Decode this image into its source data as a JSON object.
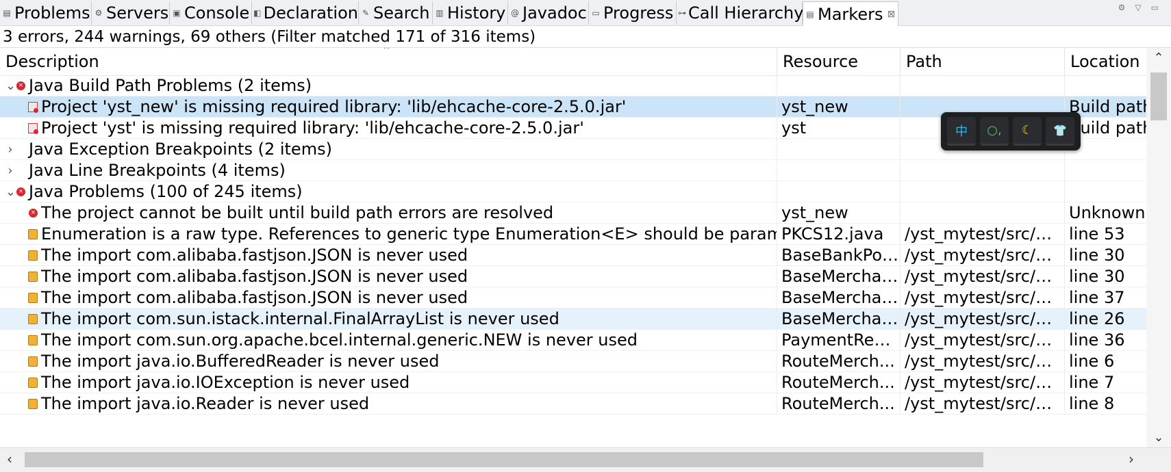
{
  "tabs": [
    {
      "label": "Problems",
      "icon": "problems-icon"
    },
    {
      "label": "Servers",
      "icon": "servers-icon"
    },
    {
      "label": "Console",
      "icon": "console-icon"
    },
    {
      "label": "Declaration",
      "icon": "declaration-icon"
    },
    {
      "label": "Search",
      "icon": "search-icon"
    },
    {
      "label": "History",
      "icon": "history-icon"
    },
    {
      "label": "Javadoc",
      "icon": "javadoc-icon"
    },
    {
      "label": "Progress",
      "icon": "progress-icon"
    },
    {
      "label": "Call Hierarchy",
      "icon": "call-hierarchy-icon"
    },
    {
      "label": "Markers",
      "icon": "markers-icon",
      "active": true,
      "close": "⊠"
    }
  ],
  "summary": "3 errors, 244 warnings, 69 others (Filter matched 171 of 316 items)",
  "columns": {
    "description": "Description",
    "resource": "Resource",
    "path": "Path",
    "location": "Location"
  },
  "rows": [
    {
      "type": "group",
      "twisty": "⌄",
      "icon": "error",
      "description": "Java Build Path Problems (2 items)",
      "resource": "",
      "path": "",
      "location": ""
    },
    {
      "type": "item",
      "icon": "lib",
      "description": "Project 'yst_new' is missing required library: 'lib/ehcache-core-2.5.0.jar'",
      "resource": "yst_new",
      "path": "",
      "location": "Build path",
      "state": "selected"
    },
    {
      "type": "item",
      "icon": "lib",
      "description": "Project 'yst' is missing required library: 'lib/ehcache-core-2.5.0.jar'",
      "resource": "yst",
      "path": "",
      "location": "Build path"
    },
    {
      "type": "group",
      "twisty": "›",
      "icon": "none",
      "description": "Java Exception Breakpoints (2 items)",
      "resource": "",
      "path": "",
      "location": ""
    },
    {
      "type": "group",
      "twisty": "›",
      "icon": "none",
      "description": "Java Line Breakpoints (4 items)",
      "resource": "",
      "path": "",
      "location": ""
    },
    {
      "type": "group",
      "twisty": "⌄",
      "icon": "error",
      "description": "Java Problems (100 of 245 items)",
      "resource": "",
      "path": "",
      "location": ""
    },
    {
      "type": "item",
      "icon": "error",
      "description": "The project cannot be built until build path errors are resolved",
      "resource": "yst_new",
      "path": "",
      "location": "Unknown"
    },
    {
      "type": "item",
      "icon": "warning",
      "description": "Enumeration is a raw type. References to generic type Enumeration<E> should be parameteri",
      "resource": "PKCS12.java",
      "path": "/yst_mytest/src/m...",
      "location": "line 53"
    },
    {
      "type": "item",
      "icon": "warning",
      "description": "The import com.alibaba.fastjson.JSON is never used",
      "resource": "BaseBankPos...",
      "path": "/yst_mytest/src/m...",
      "location": "line 30"
    },
    {
      "type": "item",
      "icon": "warning",
      "description": "The import com.alibaba.fastjson.JSON is never used",
      "resource": "BaseMerchan...",
      "path": "/yst_mytest/src/m...",
      "location": "line 30"
    },
    {
      "type": "item",
      "icon": "warning",
      "description": "The import com.alibaba.fastjson.JSON is never used",
      "resource": "BaseMerchan...",
      "path": "/yst_mytest/src/m...",
      "location": "line 37"
    },
    {
      "type": "item",
      "icon": "warning",
      "description": "The import com.sun.istack.internal.FinalArrayList is never used",
      "resource": "BaseMerchan...",
      "path": "/yst_mytest/src/m...",
      "location": "line 26",
      "state": "hover"
    },
    {
      "type": "item",
      "icon": "warning",
      "description": "The import com.sun.org.apache.bcel.internal.generic.NEW is never used",
      "resource": "PaymentRep...",
      "path": "/yst_mytest/src/m...",
      "location": "line 36"
    },
    {
      "type": "item",
      "icon": "warning",
      "description": "The import java.io.BufferedReader is never used",
      "resource": "RouteMerch...",
      "path": "/yst_mytest/src/m...",
      "location": "line 6"
    },
    {
      "type": "item",
      "icon": "warning",
      "description": "The import java.io.IOException is never used",
      "resource": "RouteMerch...",
      "path": "/yst_mytest/src/m...",
      "location": "line 7"
    },
    {
      "type": "item",
      "icon": "warning",
      "description": "The import java.io.Reader is never used",
      "resource": "RouteMerch...",
      "path": "/yst_mytest/src/m...",
      "location": "line 8"
    }
  ],
  "ime_toolbar": {
    "buttons": [
      {
        "label": "中",
        "icon": "chinese-mode-icon",
        "color": "#29b6e8"
      },
      {
        "label": "○,",
        "icon": "punctuation-icon",
        "color": "#3ecf6a"
      },
      {
        "label": "☾",
        "icon": "moon-icon",
        "color": "#f2d024"
      },
      {
        "label": "👕",
        "icon": "skin-icon",
        "color": "#29b6e8"
      }
    ]
  },
  "colors": {
    "selected_row": "#cce4f7",
    "hover_row": "#e5f1fb",
    "error": "#d9262f",
    "warning": "#f2b136"
  }
}
